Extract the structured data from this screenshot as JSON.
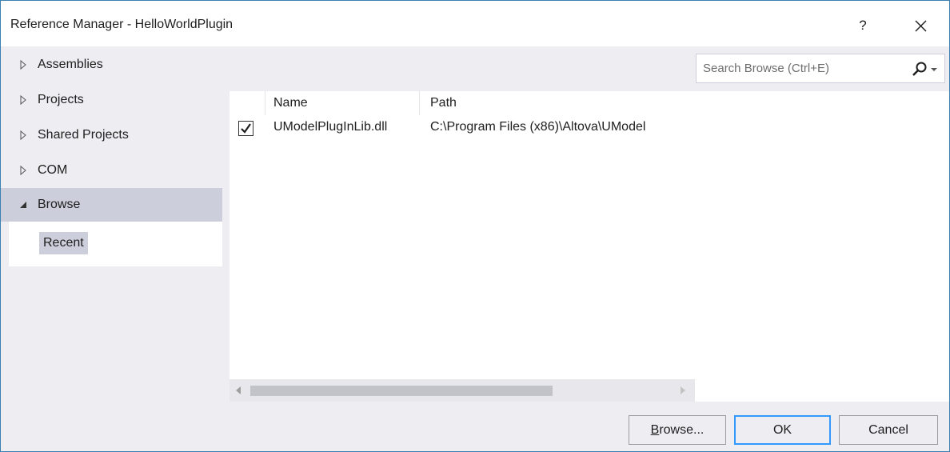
{
  "window": {
    "title": "Reference Manager - HelloWorldPlugin",
    "help_label": "?"
  },
  "nav": {
    "items": [
      {
        "label": "Assemblies",
        "expanded": false
      },
      {
        "label": "Projects",
        "expanded": false
      },
      {
        "label": "Shared Projects",
        "expanded": false
      },
      {
        "label": "COM",
        "expanded": false
      },
      {
        "label": "Browse",
        "expanded": true
      }
    ],
    "sub_items": [
      {
        "label": "Recent"
      }
    ]
  },
  "search": {
    "placeholder": "Search Browse (Ctrl+E)",
    "value": ""
  },
  "list": {
    "columns": [
      "Name",
      "Path"
    ],
    "rows": [
      {
        "checked": true,
        "name": "UModelPlugInLib.dll",
        "path": "C:\\Program Files (x86)\\Altova\\UModel"
      }
    ]
  },
  "footer": {
    "browse_label_prefix": "B",
    "browse_label_rest": "rowse...",
    "ok_label": "OK",
    "cancel_label": "Cancel"
  },
  "colors": {
    "selected_bg": "#cccedb",
    "dialog_bg": "#eeeef2",
    "focus_border": "#3399ff"
  }
}
